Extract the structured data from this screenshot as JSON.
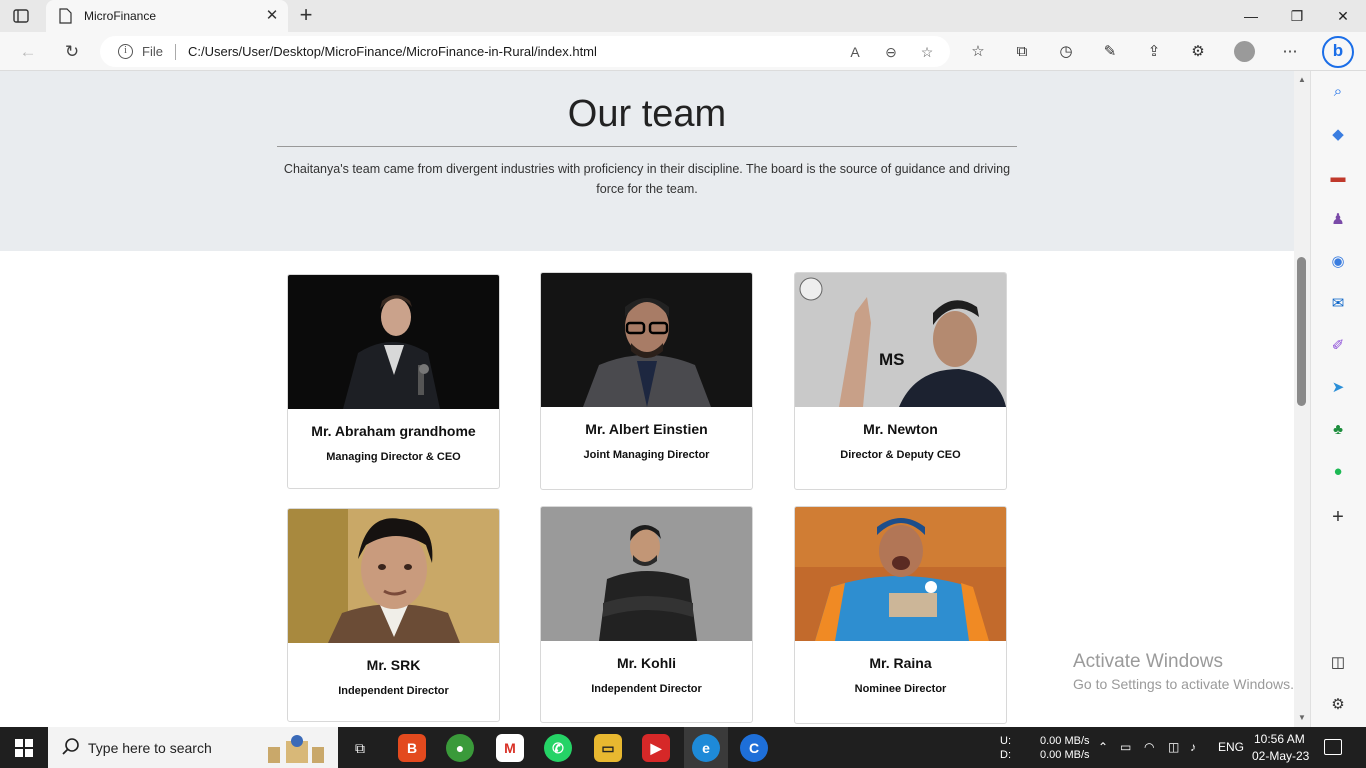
{
  "browser": {
    "tab_title": "MicroFinance",
    "address": {
      "scheme_label": "File",
      "url": "C:/Users/User/Desktop/MicroFinance/MicroFinance-in-Rural/index.html"
    }
  },
  "page": {
    "title": "Our team",
    "description": "Chaitanya's team came from divergent industries with proficiency in their discipline. The board is the source of guidance and driving force for the team.",
    "members": [
      {
        "name": "Mr. Abraham grandhome",
        "role": "Managing Director & CEO"
      },
      {
        "name": "Mr. Albert Einstien",
        "role": "Joint Managing Director"
      },
      {
        "name": "Mr. Newton",
        "role": "Director & Deputy CEO"
      },
      {
        "name": "Mr. SRK",
        "role": "Independent Director"
      },
      {
        "name": "Mr. Kohli",
        "role": "Independent Director"
      },
      {
        "name": "Mr. Raina",
        "role": "Nominee Director"
      }
    ],
    "photo3_caption": "MS"
  },
  "watermark": {
    "title": "Activate Windows",
    "subtitle": "Go to Settings to activate Windows."
  },
  "taskbar": {
    "search_placeholder": "Type here to search",
    "net_upload_label": "U:",
    "net_download_label": "D:",
    "net_upload": "0.00 MB/s",
    "net_download": "0.00 MB/s",
    "language": "ENG",
    "time": "10:56 AM",
    "date": "02-May-23"
  },
  "colors": {
    "header_bg": "#e9ecef",
    "accent": "#1b6ee8"
  }
}
